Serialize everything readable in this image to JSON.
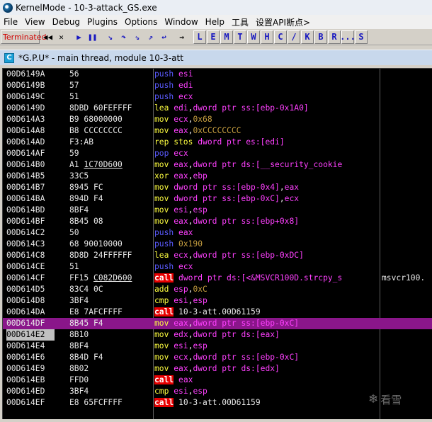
{
  "window": {
    "title": "KernelMode - 10-3-attack_GS.exe"
  },
  "menu": [
    "File",
    "View",
    "Debug",
    "Plugins",
    "Options",
    "Window",
    "Help",
    "工具",
    "设置API断点>"
  ],
  "toolbar": {
    "status": "Terminated",
    "buttons": [
      {
        "name": "rewind",
        "glyph": "◀◀",
        "color": "#000000"
      },
      {
        "name": "close",
        "glyph": "✕",
        "color": "#000000"
      },
      {
        "name": "run",
        "glyph": "▶",
        "color": "#1818c0"
      },
      {
        "name": "pause",
        "glyph": "❚❚",
        "color": "#1818c0"
      },
      {
        "name": "step-into",
        "glyph": "↘",
        "color": "#1818c0"
      },
      {
        "name": "step-over",
        "glyph": "↷",
        "color": "#1818c0"
      },
      {
        "name": "trace-into",
        "glyph": "⇘",
        "color": "#1818c0"
      },
      {
        "name": "trace-over",
        "glyph": "⇗",
        "color": "#1818c0"
      },
      {
        "name": "execute-till-return",
        "glyph": "↩",
        "color": "#1818c0"
      },
      {
        "name": "goto",
        "glyph": "→",
        "color": "#000000"
      }
    ],
    "letters": [
      "L",
      "E",
      "M",
      "T",
      "W",
      "H",
      "C",
      "/",
      "K",
      "B",
      "R",
      "...",
      "S"
    ]
  },
  "cpu_window": {
    "icon_letter": "C",
    "title": "*G.P.U* - main thread, module 10-3-att"
  },
  "rows": [
    {
      "addr": "00D6149A",
      "hex": "56",
      "dis": [
        [
          "push",
          "m-blue"
        ],
        [
          " ",
          "plain"
        ],
        [
          "esi",
          "kw-reg"
        ]
      ]
    },
    {
      "addr": "00D6149B",
      "hex": "57",
      "dis": [
        [
          "push",
          "m-blue"
        ],
        [
          " ",
          "plain"
        ],
        [
          "edi",
          "kw-reg"
        ]
      ]
    },
    {
      "addr": "00D6149C",
      "hex": "51",
      "dis": [
        [
          "push",
          "m-blue"
        ],
        [
          " ",
          "plain"
        ],
        [
          "ecx",
          "kw-reg"
        ]
      ]
    },
    {
      "addr": "00D6149D",
      "hex": "8DBD 60FEFFFF",
      "dis": [
        [
          "lea",
          "m-yellow"
        ],
        [
          " ",
          "plain"
        ],
        [
          "edi",
          "kw-reg"
        ],
        [
          ",",
          "plain"
        ],
        [
          "dword ptr ss:[ebp-0x1A0]",
          "kw-ptr"
        ]
      ]
    },
    {
      "addr": "00D614A3",
      "hex": "B9 68000000",
      "dis": [
        [
          "mov",
          "m-yellow"
        ],
        [
          " ",
          "plain"
        ],
        [
          "ecx",
          "kw-reg"
        ],
        [
          ",",
          "plain"
        ],
        [
          "0x68",
          "num"
        ]
      ]
    },
    {
      "addr": "00D614A8",
      "hex": "B8 CCCCCCCC",
      "dis": [
        [
          "mov",
          "m-yellow"
        ],
        [
          " ",
          "plain"
        ],
        [
          "eax",
          "kw-reg"
        ],
        [
          ",",
          "plain"
        ],
        [
          "0xCCCCCCCC",
          "num"
        ]
      ]
    },
    {
      "addr": "00D614AD",
      "hex": "F3:AB",
      "dis": [
        [
          "rep stos",
          "m-yellow"
        ],
        [
          " ",
          "plain"
        ],
        [
          "dword ptr es:[edi]",
          "kw-ptr"
        ]
      ]
    },
    {
      "addr": "00D614AF",
      "hex": "59",
      "dis": [
        [
          "pop",
          "m-blue"
        ],
        [
          " ",
          "plain"
        ],
        [
          "ecx",
          "kw-reg"
        ]
      ]
    },
    {
      "addr": "00D614B0",
      "hex": "A1 1C70D600",
      "hexu": "1C70D600",
      "dis": [
        [
          "mov",
          "m-yellow"
        ],
        [
          " ",
          "plain"
        ],
        [
          "eax",
          "kw-reg"
        ],
        [
          ",",
          "plain"
        ],
        [
          "dword ptr ds:[__security_cookie",
          "kw-ptr"
        ]
      ]
    },
    {
      "addr": "00D614B5",
      "hex": "33C5",
      "dis": [
        [
          "xor",
          "m-yellow"
        ],
        [
          " ",
          "plain"
        ],
        [
          "eax",
          "kw-reg"
        ],
        [
          ",",
          "plain"
        ],
        [
          "ebp",
          "kw-reg"
        ]
      ]
    },
    {
      "addr": "00D614B7",
      "hex": "8945 FC",
      "dis": [
        [
          "mov",
          "m-yellow"
        ],
        [
          " ",
          "plain"
        ],
        [
          "dword ptr ss:[ebp-0x4]",
          "kw-ptr"
        ],
        [
          ",",
          "plain"
        ],
        [
          "eax",
          "kw-reg"
        ]
      ]
    },
    {
      "addr": "00D614BA",
      "hex": "894D F4",
      "dis": [
        [
          "mov",
          "m-yellow"
        ],
        [
          " ",
          "plain"
        ],
        [
          "dword ptr ss:[ebp-0xC]",
          "kw-ptr"
        ],
        [
          ",",
          "plain"
        ],
        [
          "ecx",
          "kw-reg"
        ]
      ]
    },
    {
      "addr": "00D614BD",
      "hex": "8BF4",
      "dis": [
        [
          "mov",
          "m-yellow"
        ],
        [
          " ",
          "plain"
        ],
        [
          "esi",
          "kw-reg"
        ],
        [
          ",",
          "plain"
        ],
        [
          "esp",
          "kw-reg"
        ]
      ]
    },
    {
      "addr": "00D614BF",
      "hex": "8B45 08",
      "dis": [
        [
          "mov",
          "m-yellow"
        ],
        [
          " ",
          "plain"
        ],
        [
          "eax",
          "kw-reg"
        ],
        [
          ",",
          "plain"
        ],
        [
          "dword ptr ss:[ebp+0x8]",
          "kw-ptr"
        ]
      ]
    },
    {
      "addr": "00D614C2",
      "hex": "50",
      "dis": [
        [
          "push",
          "m-blue"
        ],
        [
          " ",
          "plain"
        ],
        [
          "eax",
          "kw-reg"
        ]
      ]
    },
    {
      "addr": "00D614C3",
      "hex": "68 90010000",
      "dis": [
        [
          "push",
          "m-blue"
        ],
        [
          " ",
          "plain"
        ],
        [
          "0x190",
          "num"
        ]
      ]
    },
    {
      "addr": "00D614C8",
      "hex": "8D8D 24FFFFFF",
      "dis": [
        [
          "lea",
          "m-yellow"
        ],
        [
          " ",
          "plain"
        ],
        [
          "ecx",
          "kw-reg"
        ],
        [
          ",",
          "plain"
        ],
        [
          "dword ptr ss:[ebp-0xDC]",
          "kw-ptr"
        ]
      ]
    },
    {
      "addr": "00D614CE",
      "hex": "51",
      "dis": [
        [
          "push",
          "m-blue"
        ],
        [
          " ",
          "plain"
        ],
        [
          "ecx",
          "kw-reg"
        ]
      ]
    },
    {
      "addr": "00D614CF",
      "hex": "FF15 C082D600",
      "hexu": "C082D600",
      "dis": [
        [
          "call",
          "m-call"
        ],
        [
          " ",
          "plain"
        ],
        [
          "dword ptr ds:[<&MSVCR100D.strcpy_s",
          "kw-ptr"
        ]
      ],
      "cmt": "msvcr100."
    },
    {
      "addr": "00D614D5",
      "hex": "83C4 0C",
      "dis": [
        [
          "add",
          "m-yellow"
        ],
        [
          " ",
          "plain"
        ],
        [
          "esp",
          "kw-reg"
        ],
        [
          ",",
          "plain"
        ],
        [
          "0xC",
          "num"
        ]
      ]
    },
    {
      "addr": "00D614D8",
      "hex": "3BF4",
      "dis": [
        [
          "cmp",
          "m-yellow"
        ],
        [
          " ",
          "plain"
        ],
        [
          "esi",
          "kw-reg"
        ],
        [
          ",",
          "plain"
        ],
        [
          "esp",
          "kw-reg"
        ]
      ]
    },
    {
      "addr": "00D614DA",
      "hex": "E8 7AFCFFFF",
      "dis": [
        [
          "call",
          "m-call"
        ],
        [
          " ",
          "plain"
        ],
        [
          "10-3-att.00D61159",
          "plain"
        ]
      ]
    },
    {
      "addr": "00D614DF",
      "hex": "8B45 F4",
      "selected": true,
      "dis": [
        [
          "mov",
          "m-yellow"
        ],
        [
          " ",
          "plain"
        ],
        [
          "eax",
          "kw-reg"
        ],
        [
          ",",
          "plain"
        ],
        [
          "dword ptr ss:[ebp-0xC]",
          "kw-ptr"
        ]
      ]
    },
    {
      "addr": "00D614E2",
      "hex": "8B10",
      "eip": true,
      "dis": [
        [
          "mov",
          "m-yellow"
        ],
        [
          " ",
          "plain"
        ],
        [
          "edx",
          "kw-reg"
        ],
        [
          ",",
          "plain"
        ],
        [
          "dword ptr ds:[eax]",
          "kw-ptr"
        ]
      ]
    },
    {
      "addr": "00D614E4",
      "hex": "8BF4",
      "dis": [
        [
          "mov",
          "m-yellow"
        ],
        [
          " ",
          "plain"
        ],
        [
          "esi",
          "kw-reg"
        ],
        [
          ",",
          "plain"
        ],
        [
          "esp",
          "kw-reg"
        ]
      ]
    },
    {
      "addr": "00D614E6",
      "hex": "8B4D F4",
      "dis": [
        [
          "mov",
          "m-yellow"
        ],
        [
          " ",
          "plain"
        ],
        [
          "ecx",
          "kw-reg"
        ],
        [
          ",",
          "plain"
        ],
        [
          "dword ptr ss:[ebp-0xC]",
          "kw-ptr"
        ]
      ]
    },
    {
      "addr": "00D614E9",
      "hex": "8B02",
      "dis": [
        [
          "mov",
          "m-yellow"
        ],
        [
          " ",
          "plain"
        ],
        [
          "eax",
          "kw-reg"
        ],
        [
          ",",
          "plain"
        ],
        [
          "dword ptr ds:[edx]",
          "kw-ptr"
        ]
      ]
    },
    {
      "addr": "00D614EB",
      "hex": "FFD0",
      "dis": [
        [
          "call",
          "m-call"
        ],
        [
          " ",
          "plain"
        ],
        [
          "eax",
          "kw-reg"
        ]
      ]
    },
    {
      "addr": "00D614ED",
      "hex": "3BF4",
      "dis": [
        [
          "cmp",
          "m-yellow"
        ],
        [
          " ",
          "plain"
        ],
        [
          "esi",
          "kw-reg"
        ],
        [
          ",",
          "plain"
        ],
        [
          "esp",
          "kw-reg"
        ]
      ]
    },
    {
      "addr": "00D614EF",
      "hex": "E8 65FCFFFF",
      "dis": [
        [
          "call",
          "m-call"
        ],
        [
          " ",
          "plain"
        ],
        [
          "10-3-att.00D61159",
          "plain"
        ]
      ]
    }
  ],
  "watermark": {
    "glyph": "❄",
    "text": "看雪"
  },
  "colors": {
    "selected_row": "#8a168a",
    "mnemonic_push": "#5a5aff",
    "mnemonic_general": "#ffff40",
    "mnemonic_call_bg": "#e80000",
    "operand_memory": "#ff40ff",
    "immediate": "#c8a040",
    "background": "#000000"
  }
}
